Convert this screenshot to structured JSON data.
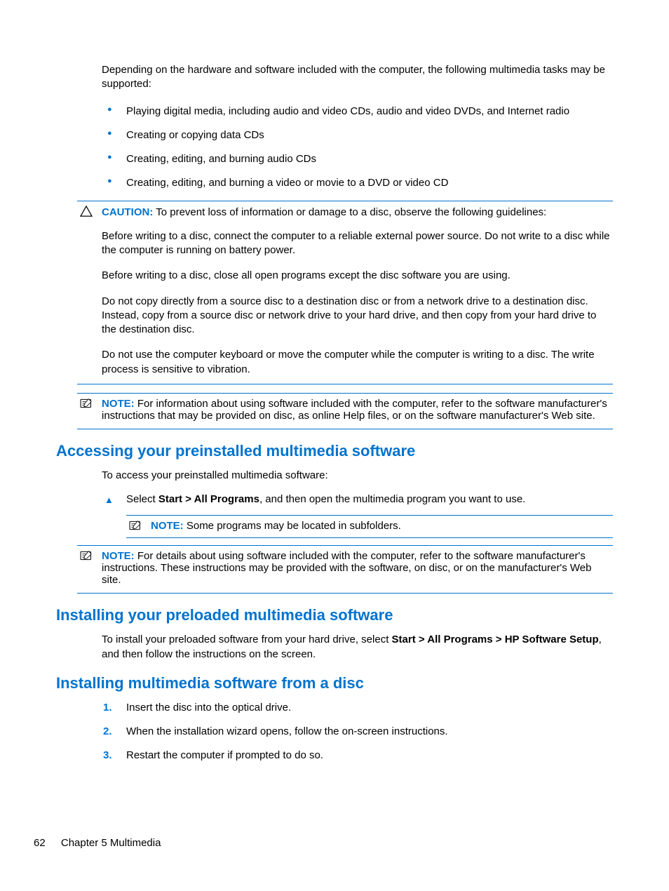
{
  "intro": "Depending on the hardware and software included with the computer, the following multimedia tasks may be supported:",
  "bullets": [
    "Playing digital media, including audio and video CDs, audio and video DVDs, and Internet radio",
    "Creating or copying data CDs",
    "Creating, editing, and burning audio CDs",
    "Creating, editing, and burning a video or movie to a DVD or video CD"
  ],
  "caution": {
    "label": "CAUTION:",
    "lead": "To prevent loss of information or damage to a disc, observe the following guidelines:",
    "paras": [
      "Before writing to a disc, connect the computer to a reliable external power source. Do not write to a disc while the computer is running on battery power.",
      "Before writing to a disc, close all open programs except the disc software you are using.",
      "Do not copy directly from a source disc to a destination disc or from a network drive to a destination disc. Instead, copy from a source disc or network drive to your hard drive, and then copy from your hard drive to the destination disc.",
      "Do not use the computer keyboard or move the computer while the computer is writing to a disc. The write process is sensitive to vibration."
    ]
  },
  "note1": {
    "label": "NOTE:",
    "text": "For information about using software included with the computer, refer to the software manufacturer's instructions that may be provided on disc, as online Help files, or on the software manufacturer's Web site."
  },
  "section1": {
    "heading": "Accessing your preinstalled multimedia software",
    "intro": "To access your preinstalled multimedia software:",
    "step_prefix": "Select ",
    "step_bold": "Start > All Programs",
    "step_suffix": ", and then open the multimedia program you want to use.",
    "nested_note": {
      "label": "NOTE:",
      "text": "Some programs may be located in subfolders."
    },
    "note": {
      "label": "NOTE:",
      "text": "For details about using software included with the computer, refer to the software manufacturer's instructions. These instructions may be provided with the software, on disc, or on the manufacturer's Web site."
    }
  },
  "section2": {
    "heading": "Installing your preloaded multimedia software",
    "p_prefix": "To install your preloaded software from your hard drive, select ",
    "p_bold": "Start > All Programs > HP Software Setup",
    "p_suffix": ", and then follow the instructions on the screen."
  },
  "section3": {
    "heading": "Installing multimedia software from a disc",
    "steps": [
      "Insert the disc into the optical drive.",
      "When the installation wizard opens, follow the on-screen instructions.",
      "Restart the computer if prompted to do so."
    ],
    "nums": [
      "1.",
      "2.",
      "3."
    ]
  },
  "footer": {
    "page": "62",
    "chapter": "Chapter 5   Multimedia"
  }
}
